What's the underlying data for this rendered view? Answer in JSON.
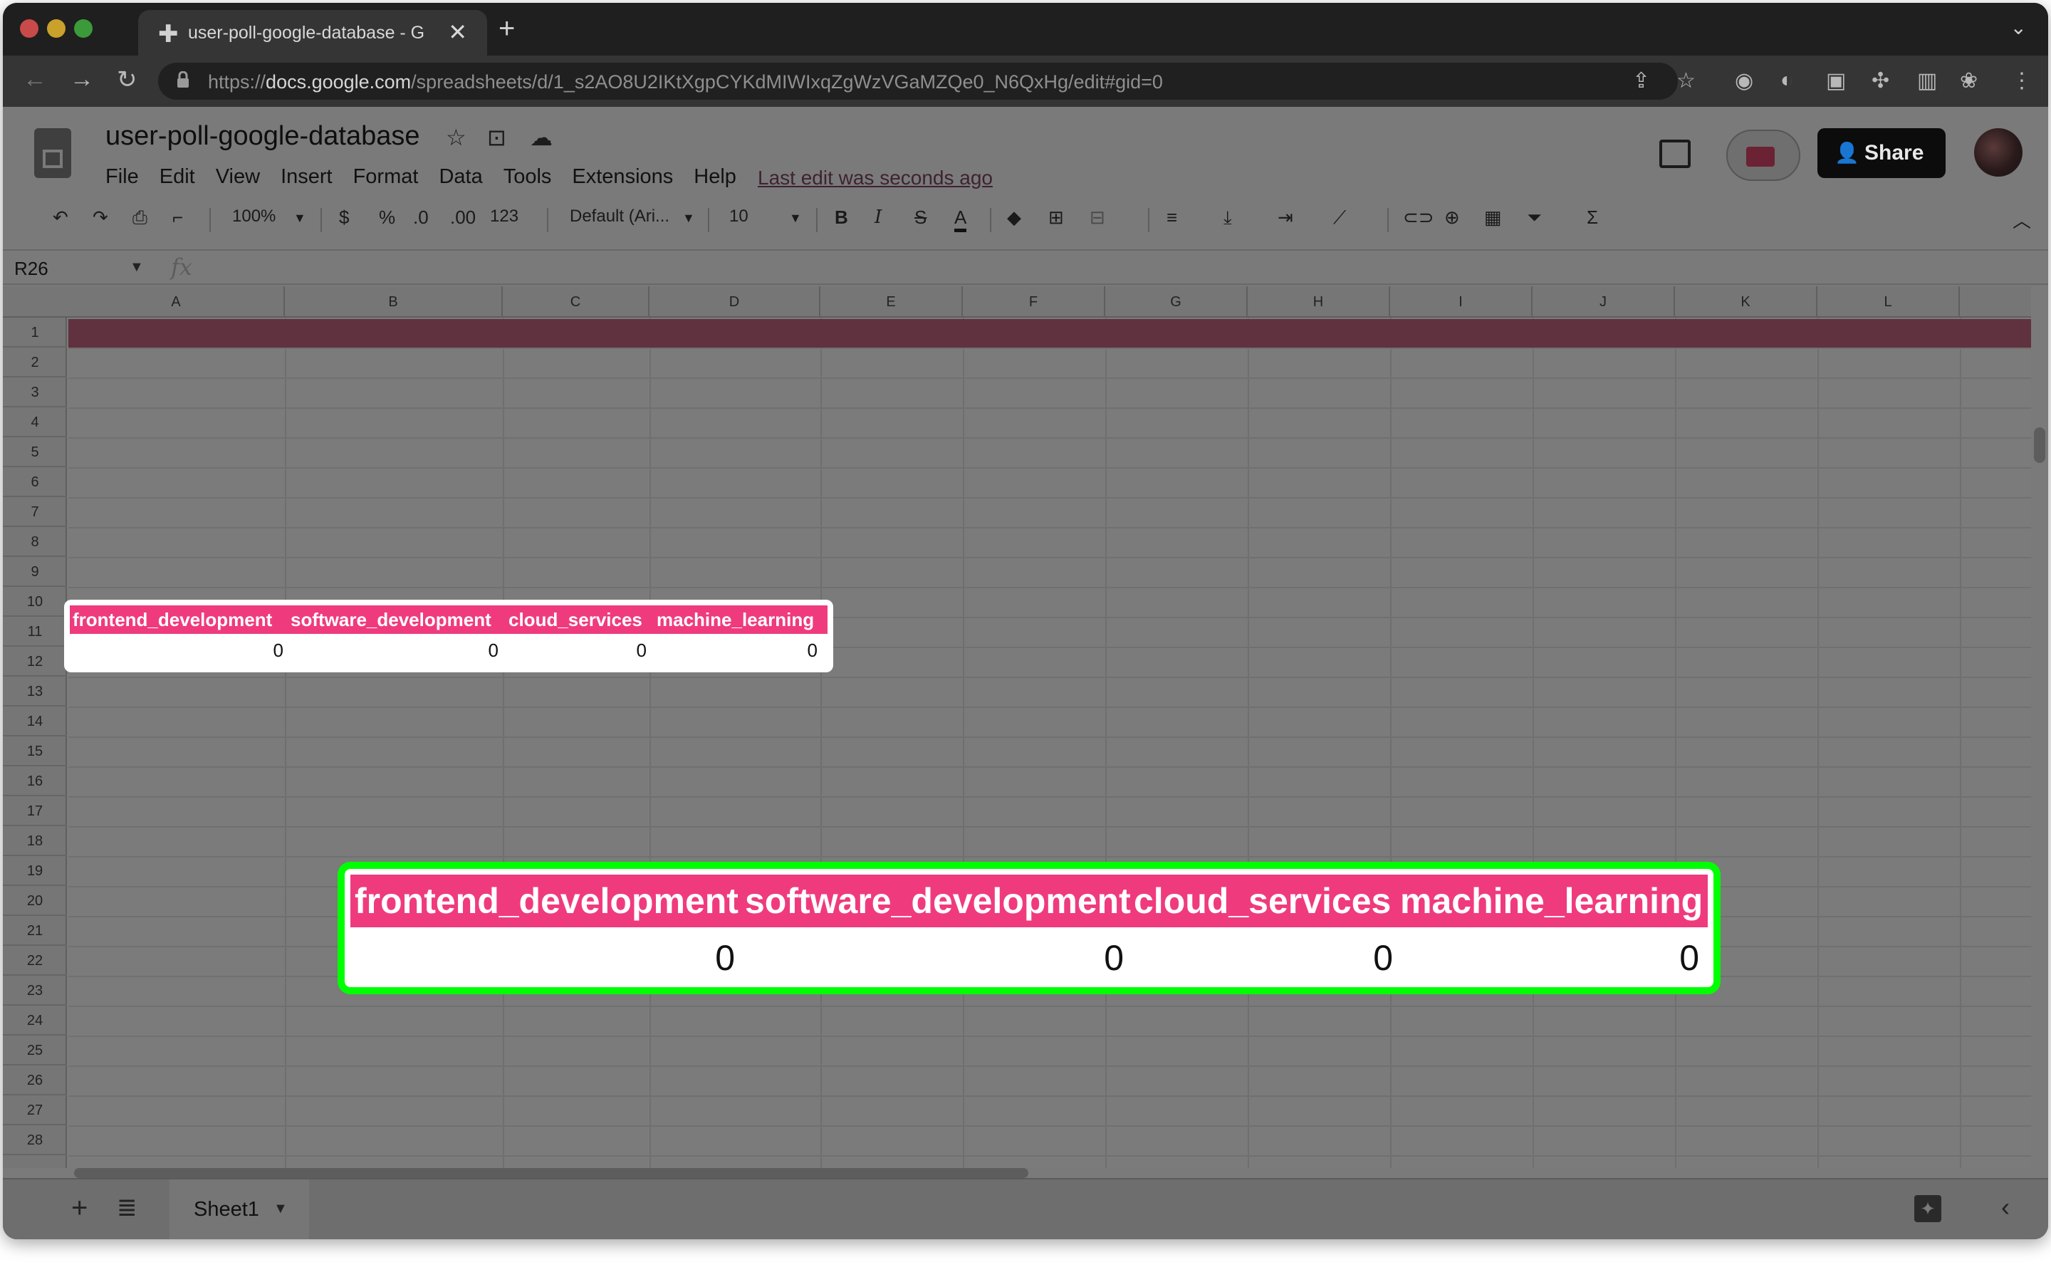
{
  "browser": {
    "tab_title": "user-poll-google-database - G",
    "url_scheme": "https://",
    "url_host": "docs.google.com",
    "url_path": "/spreadsheets/d/1_s2AO8U2IKtXgpCYKdMIWIxqZgWzVGaMZQe0_N6QxHg/edit#gid=0",
    "new_tab_symbol": "+",
    "close_symbol": "✕"
  },
  "doc": {
    "title": "user-poll-google-database",
    "menu": [
      "File",
      "Edit",
      "View",
      "Insert",
      "Format",
      "Data",
      "Tools",
      "Extensions",
      "Help"
    ],
    "last_edit": "Last edit was seconds ago",
    "share_label": "Share"
  },
  "toolbar": {
    "zoom": "100%",
    "currency": "$",
    "percent": "%",
    "dec_less": ".0",
    "dec_more": ".00",
    "format_more": "123",
    "font": "Default (Ari...",
    "font_size": "10",
    "bold": "B",
    "italic": "I",
    "strike": "S",
    "text_color": "A"
  },
  "formula_bar": {
    "name_box": "R26",
    "fx": "fx"
  },
  "grid": {
    "columns": [
      "A",
      "B",
      "C",
      "D",
      "E",
      "F",
      "G",
      "H",
      "I",
      "J",
      "K",
      "L"
    ],
    "rows": [
      "1",
      "2",
      "3",
      "4",
      "5",
      "6",
      "7",
      "8",
      "9",
      "10",
      "11",
      "12",
      "13",
      "14",
      "15",
      "16",
      "17",
      "18",
      "19",
      "20",
      "21",
      "22",
      "23",
      "24",
      "25",
      "26",
      "27",
      "28"
    ],
    "headers": [
      "frontend_development",
      "software_development",
      "cloud_services",
      "machine_learning"
    ],
    "values": [
      "0",
      "0",
      "0",
      "0"
    ]
  },
  "sheets": {
    "active": "Sheet1"
  },
  "colors": {
    "header_pink": "#ef3b7d",
    "highlight_green": "#00ff00",
    "row1_band": "#60313f"
  }
}
